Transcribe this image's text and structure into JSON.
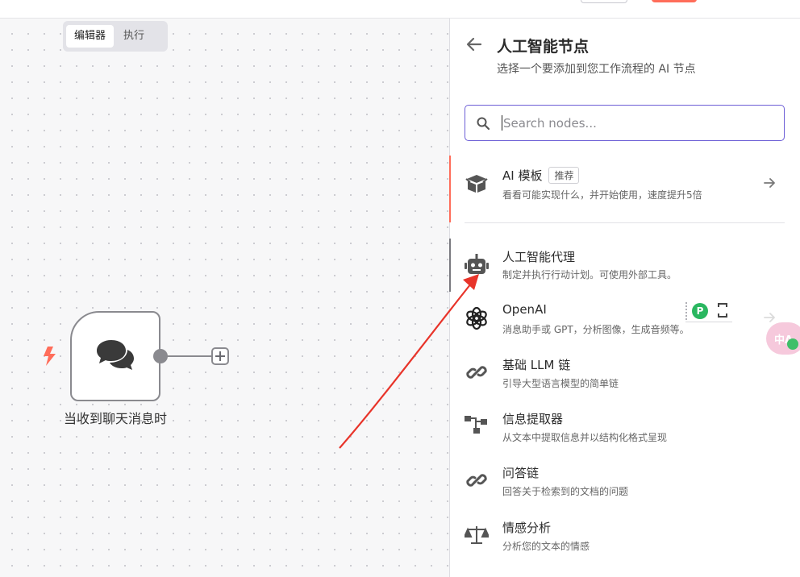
{
  "canvas": {
    "mode_tabs": [
      {
        "label": "编辑器",
        "active": true
      },
      {
        "label": "执行",
        "active": false
      }
    ],
    "node": {
      "label": "当收到聊天消息时",
      "icon": "chat-bubbles-icon",
      "trigger_icon": "lightning-bolt-icon"
    }
  },
  "panel": {
    "title": "人工智能节点",
    "subtitle": "选择一个要添加到您工作流程的 AI 节点",
    "search": {
      "placeholder": "Search nodes...",
      "value": ""
    },
    "template_item": {
      "title": "AI 模板",
      "badge": "推荐",
      "description": "看看可能实现什么，并开始使用，速度提升5倍",
      "icon": "open-box-icon"
    },
    "items": [
      {
        "title": "人工智能代理",
        "description": "制定并执行行动计划。可使用外部工具。",
        "icon": "robot-icon"
      },
      {
        "title": "OpenAI",
        "description": "消息助手或 GPT，分析图像，生成音频等。",
        "icon": "openai-logo-icon"
      },
      {
        "title": "基础 LLM 链",
        "description": "引导大型语言模型的简单链",
        "icon": "link-icon"
      },
      {
        "title": "信息提取器",
        "description": "从文本中提取信息并以结构化格式呈现",
        "icon": "tree-structure-icon"
      },
      {
        "title": "问答链",
        "description": "回答关于检索到的文档的问题",
        "icon": "link-icon"
      },
      {
        "title": "情感分析",
        "description": "分析您的文本的情感",
        "icon": "balance-scale-icon"
      }
    ]
  },
  "overlay": {
    "translate_label": "中A"
  },
  "colors": {
    "accent": "#ff6d5a",
    "search_border": "#6c5ed6",
    "annotation_arrow": "#e8342a"
  }
}
